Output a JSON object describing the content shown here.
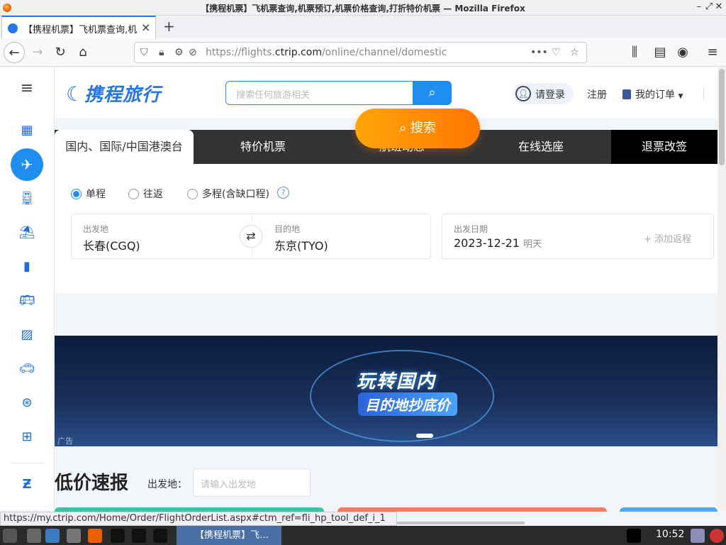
{
  "window": {
    "title": "【携程机票】飞机票查询,机票预订,机票价格查询,打折特价机票 — Mozilla Firefox"
  },
  "tab": {
    "label": "【携程机票】飞机票查询,机"
  },
  "url": {
    "prefix": "https://flights.",
    "domain": "ctrip.com",
    "path": "/online/channel/domestic"
  },
  "header": {
    "logo": "携程旅行",
    "search_placeholder": "搜索任何旅游相关",
    "login": "请登录",
    "register": "注册",
    "orders": "我的订单"
  },
  "flight_tabs": [
    "国内、国际/中国港澳台",
    "特价机票",
    "航班动态",
    "在线选座",
    "退票改签"
  ],
  "trip_types": [
    "单程",
    "往返",
    "多程(含缺口程)"
  ],
  "form": {
    "from_label": "出发地",
    "from_value": "长春(CGQ)",
    "to_label": "目的地",
    "to_value": "东京(TYO)",
    "date_label": "出发日期",
    "date_value": "2023-12-21",
    "date_hint": "明天",
    "add_return": "+ 添加返程",
    "search_button": "搜索"
  },
  "banner": {
    "title": "玩转国内",
    "subtitle": "目的地抄底价",
    "ad": "广告"
  },
  "low_price": {
    "title": "低价速报",
    "from_label": "出发地：",
    "from_placeholder": "请输入出发地"
  },
  "status_url": "https://my.ctrip.com/Home/Order/FlightOrderList.aspx#ctm_ref=fli_hp_tool_def_i_1",
  "taskbar": {
    "task": "【携程机票】飞…",
    "clock": "10:52"
  }
}
